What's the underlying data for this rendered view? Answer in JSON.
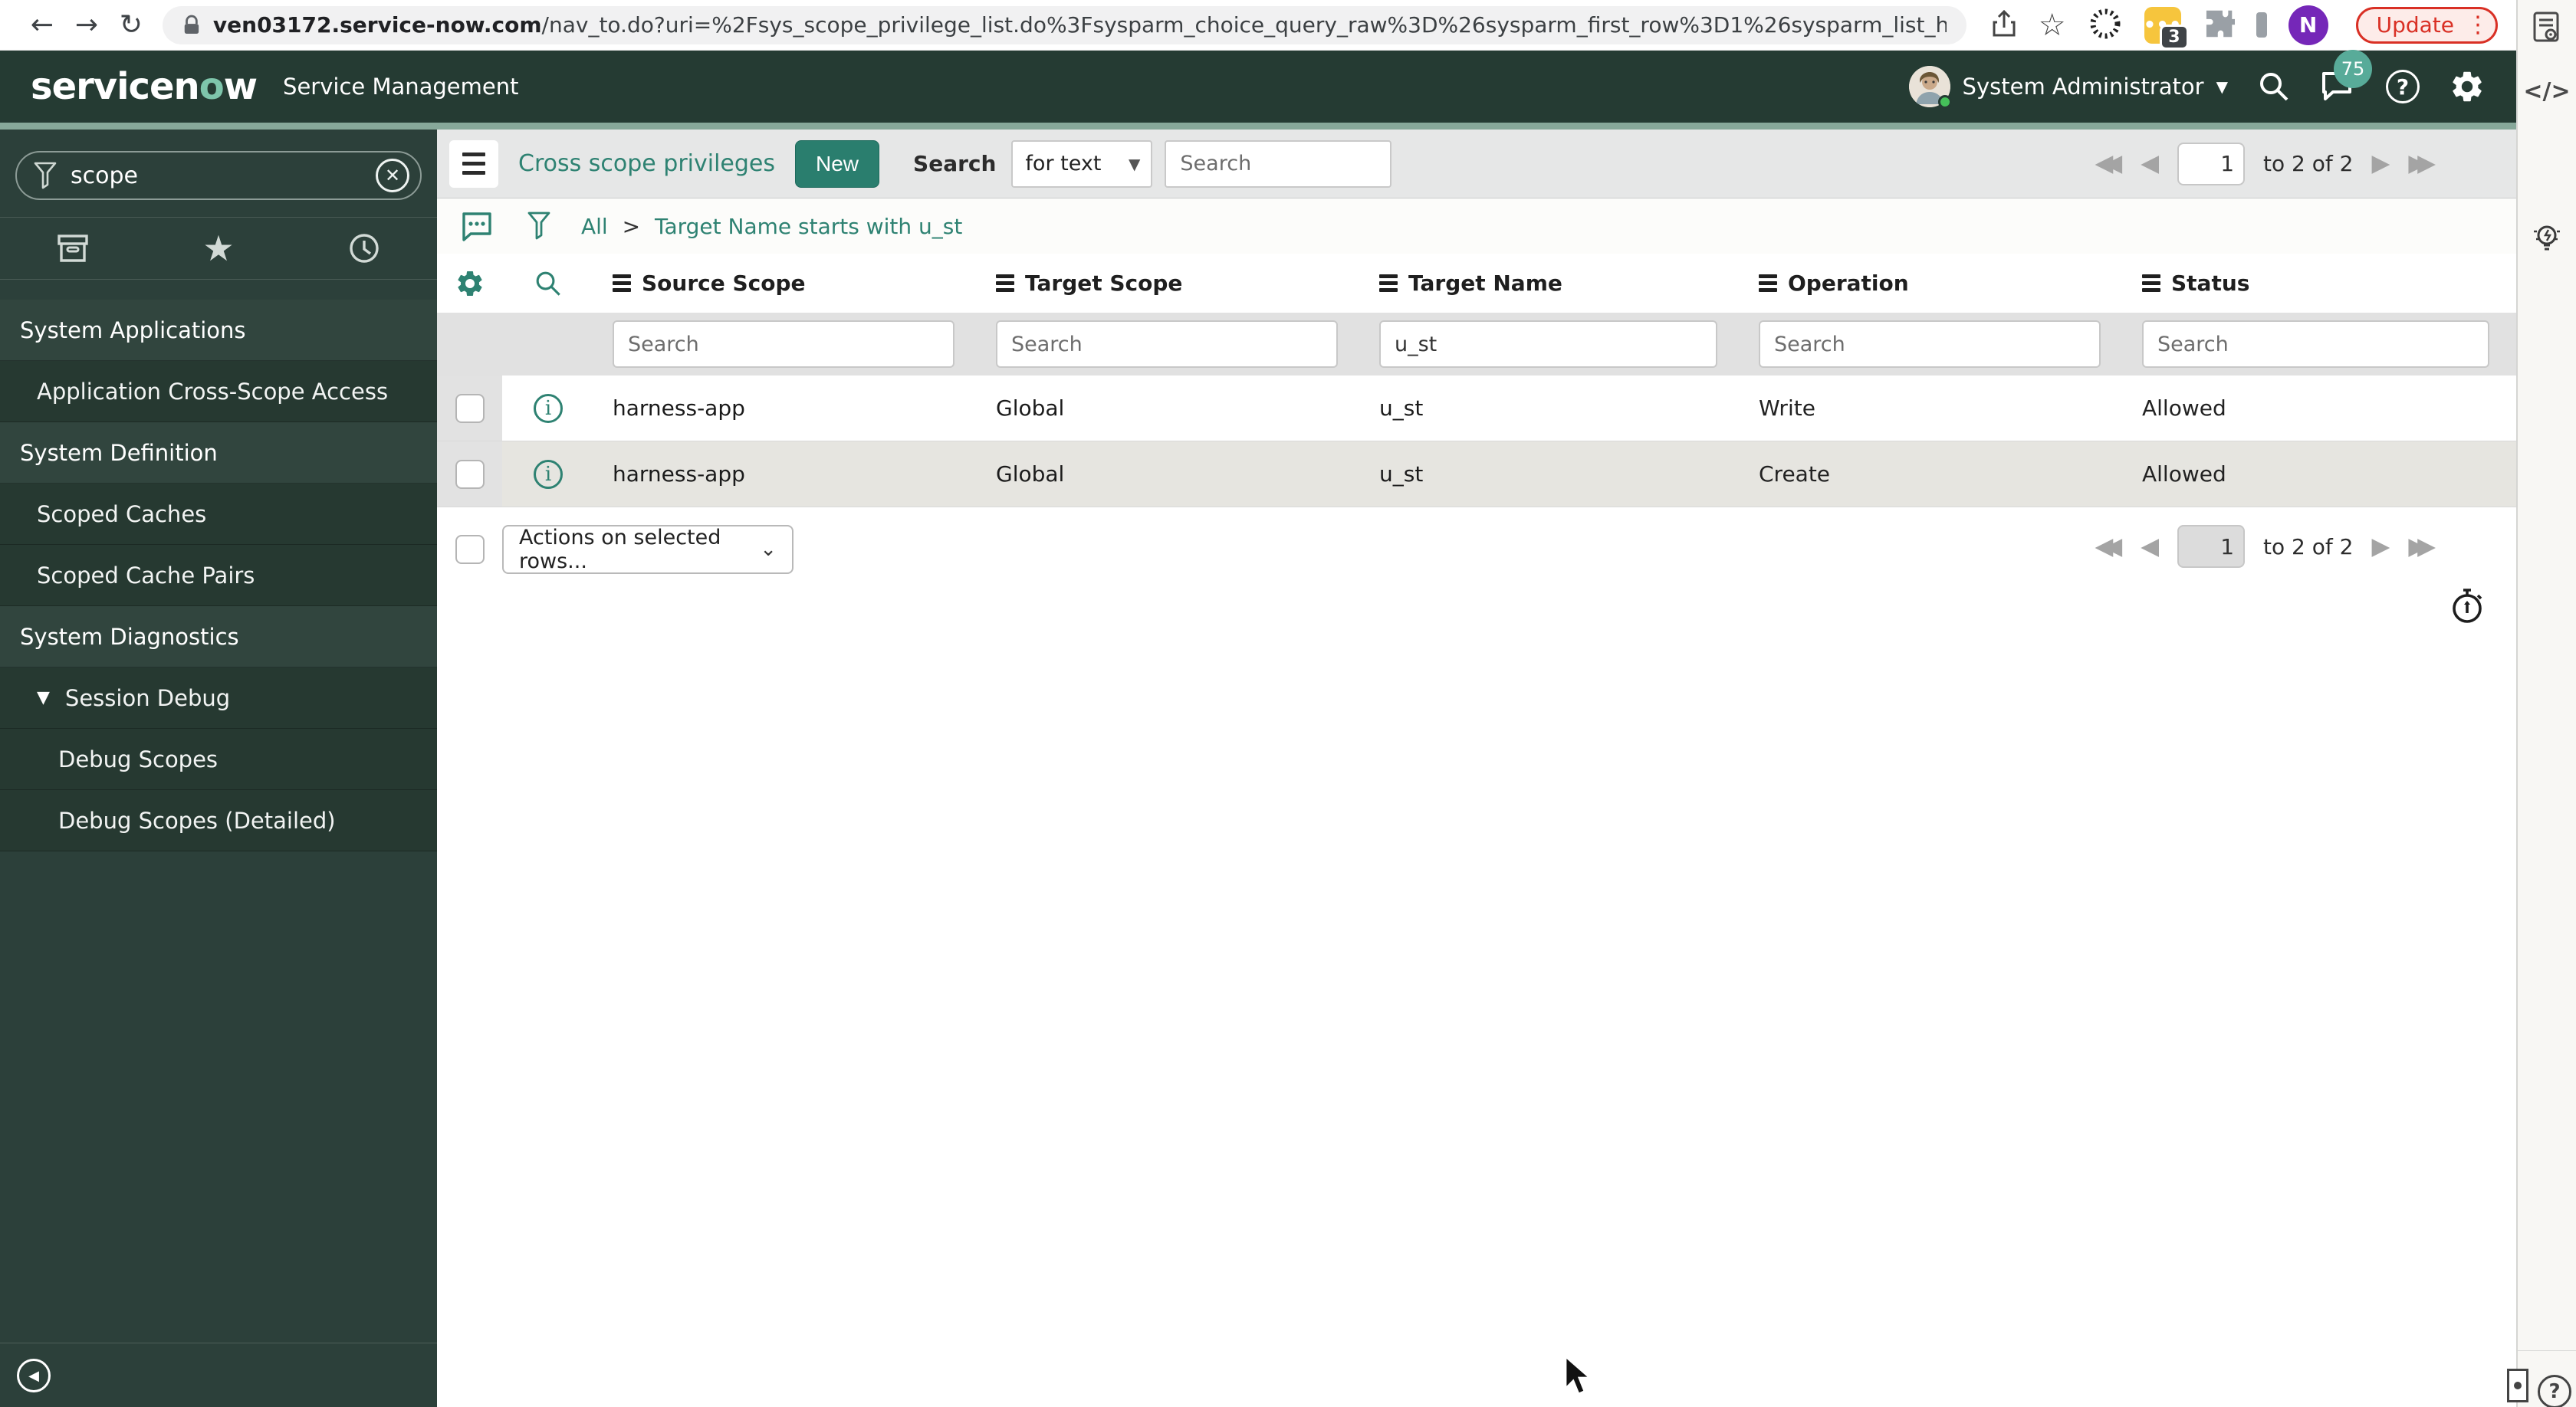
{
  "browser": {
    "url_domain": "ven03172.service-now.com",
    "url_path": "/nav_to.do?uri=%2Fsys_scope_privilege_list.do%3Fsysparm_choice_query_raw%3D%26sysparm_first_row%3D1%26sysparm_list_header_searc...",
    "update_label": "Update",
    "extension_badge": "3",
    "profile_initial": "N"
  },
  "header": {
    "logo_part1": "servicen",
    "logo_o": "o",
    "logo_part2": "w",
    "product": "Service Management",
    "user": "System Administrator",
    "notification_count": "75",
    "help_glyph": "?"
  },
  "sidebar": {
    "search_value": "scope",
    "items": [
      {
        "label": "System Applications",
        "type": "section"
      },
      {
        "label": "Application Cross-Scope Access",
        "type": "child"
      },
      {
        "label": "System Definition",
        "type": "section"
      },
      {
        "label": "Scoped Caches",
        "type": "child"
      },
      {
        "label": "Scoped Cache Pairs",
        "type": "child"
      },
      {
        "label": "System Diagnostics",
        "type": "section"
      },
      {
        "label": "Session Debug",
        "type": "child-expanded"
      },
      {
        "label": "Debug Scopes",
        "type": "sub"
      },
      {
        "label": "Debug Scopes (Detailed)",
        "type": "sub"
      }
    ]
  },
  "toolbar": {
    "title": "Cross scope privileges",
    "new_label": "New",
    "search_label": "Search",
    "search_type": "for text",
    "search_placeholder": "Search"
  },
  "pagination": {
    "page": "1",
    "range": "to 2 of 2"
  },
  "breadcrumb": {
    "all": "All",
    "sep": ">",
    "filter": "Target Name starts with u_st"
  },
  "table": {
    "columns": [
      "Source Scope",
      "Target Scope",
      "Target Name",
      "Operation",
      "Status"
    ],
    "filter_placeholder": "Search",
    "filter_target_name": "u_st",
    "rows": [
      {
        "source_scope": "harness-app",
        "target_scope": "Global",
        "target_name": "u_st",
        "operation": "Write",
        "status": "Allowed"
      },
      {
        "source_scope": "harness-app",
        "target_scope": "Global",
        "target_name": "u_st",
        "operation": "Create",
        "status": "Allowed"
      }
    ],
    "actions_label": "Actions on selected rows..."
  },
  "right_panel": {
    "code_glyph": "</>"
  },
  "icons": {
    "caret_down": "▼",
    "prev": "◀",
    "next": "▶",
    "dots_vertical": "⋮",
    "cross": "✕",
    "back": "←",
    "forward": "→",
    "reload": "↻",
    "star": "☆",
    "star_filled": "★",
    "chevron": "⌄"
  },
  "colors": {
    "header_bg": "#253b33",
    "sidebar_bg": "#2c403a",
    "accent_teal": "#2e8272",
    "new_button": "#2a7e6e",
    "header_strip": "#87a89a",
    "update_red": "#d93025",
    "badge_teal": "#58ab99",
    "profile_purple": "#7527b8",
    "extension_yellow": "#f6c53d",
    "row_alt": "#e6e5e0"
  }
}
